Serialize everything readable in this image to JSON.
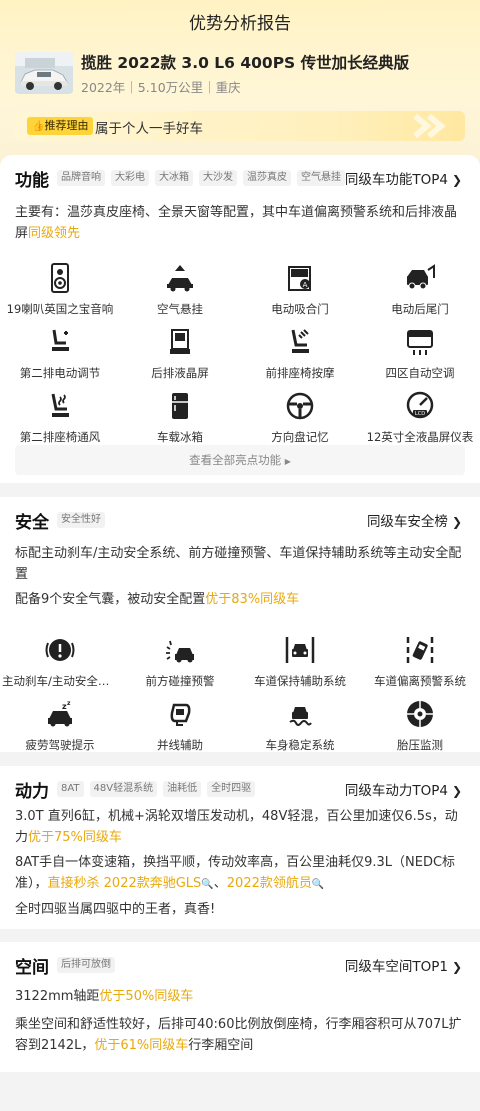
{
  "page": {
    "title": "优势分析报告"
  },
  "car": {
    "name": "揽胜 2022款 3.0 L6 400PS 传世加长经典版",
    "meta": "2022年｜5.10万公里｜重庆"
  },
  "reason": {
    "tag": "推荐理由",
    "text": "属于个人一手好车"
  },
  "function": {
    "title": "功能",
    "chips": [
      "品牌音响",
      "大彩电",
      "大冰箱",
      "大沙发",
      "温莎真皮",
      "空气悬挂"
    ],
    "link": "同级车功能TOP4",
    "summary_prefix": "主要有：温莎真皮座椅、全景天窗等配置，其中车道偏离预警系统和后排液晶屏",
    "summary_highlight": "同级领先",
    "features": [
      {
        "label": "19喇叭英国之宝音响",
        "icon": "speaker-icon"
      },
      {
        "label": "空气悬挂",
        "icon": "air-suspension-icon"
      },
      {
        "label": "电动吸合门",
        "icon": "soft-close-door-icon"
      },
      {
        "label": "电动后尾门",
        "icon": "power-tailgate-icon"
      },
      {
        "label": "第二排电动调节",
        "icon": "power-seat-icon"
      },
      {
        "label": "后排液晶屏",
        "icon": "rear-screen-icon"
      },
      {
        "label": "前排座椅按摩",
        "icon": "seat-massage-icon"
      },
      {
        "label": "四区自动空调",
        "icon": "climate-control-icon"
      },
      {
        "label": "第二排座椅通风",
        "icon": "seat-ventilation-icon"
      },
      {
        "label": "车载冰箱",
        "icon": "fridge-icon"
      },
      {
        "label": "方向盘记忆",
        "icon": "steering-memory-icon"
      },
      {
        "label": "12英寸全液晶屏仪表",
        "icon": "lcd-cluster-icon"
      }
    ],
    "view_all": "查看全部亮点功能"
  },
  "safety": {
    "title": "安全",
    "chips": [
      "安全性好"
    ],
    "link": "同级车安全榜",
    "p1": "标配主动刹车/主动安全系统、前方碰撞预警、车道保持辅助系统等主动安全配置",
    "p2_prefix": "配备9个安全气囊，被动安全配置",
    "p2_highlight": "优于83%同级车",
    "features": [
      {
        "label": "主动刹车/主动安全系统",
        "icon": "active-brake-icon"
      },
      {
        "label": "前方碰撞预警",
        "icon": "collision-warning-icon"
      },
      {
        "label": "车道保持辅助系统",
        "icon": "lane-keep-icon"
      },
      {
        "label": "车道偏离预警系统",
        "icon": "lane-departure-icon"
      },
      {
        "label": "疲劳驾驶提示",
        "icon": "fatigue-alert-icon"
      },
      {
        "label": "并线辅助",
        "icon": "blind-spot-icon"
      },
      {
        "label": "车身稳定系统",
        "icon": "stability-control-icon"
      },
      {
        "label": "胎压监测",
        "icon": "tire-pressure-icon"
      }
    ]
  },
  "power": {
    "title": "动力",
    "chips": [
      "8AT",
      "48V轻混系统",
      "油耗低",
      "全时四驱"
    ],
    "link": "同级车动力TOP4",
    "p1_prefix": "3.0T 直列6缸，机械+涡轮双增压发动机，48V轻混，百公里加速仅6.5s，动力",
    "p1_highlight": "优于75%同级车",
    "p2_prefix": "8AT手自一体变速箱，换挡平顺，传动效率高，百公里油耗仅9.3L（NEDC标准），",
    "p2_highlight1": "直接秒杀 2022款奔驰GLS",
    "p2_sep": "、",
    "p2_highlight2": "2022款领航员",
    "p3": "全时四驱当属四驱中的王者，真香!"
  },
  "space": {
    "title": "空间",
    "chips": [
      "后排可放倒"
    ],
    "link": "同级车空间TOP1",
    "p1_prefix": "3122mm轴距",
    "p1_highlight": "优于50%同级车",
    "p2_prefix": "乘坐空间和舒适性较好，后排可40:60比例放倒座椅，行李厢容积可从707L扩容到2142L，",
    "p2_highlight": "优于61%同级车",
    "p2_suffix": "行李厢空间"
  },
  "colors": {
    "accent": "#e8a90c",
    "tag": "#ffd43a",
    "hero_bg": "#fff3c4"
  }
}
